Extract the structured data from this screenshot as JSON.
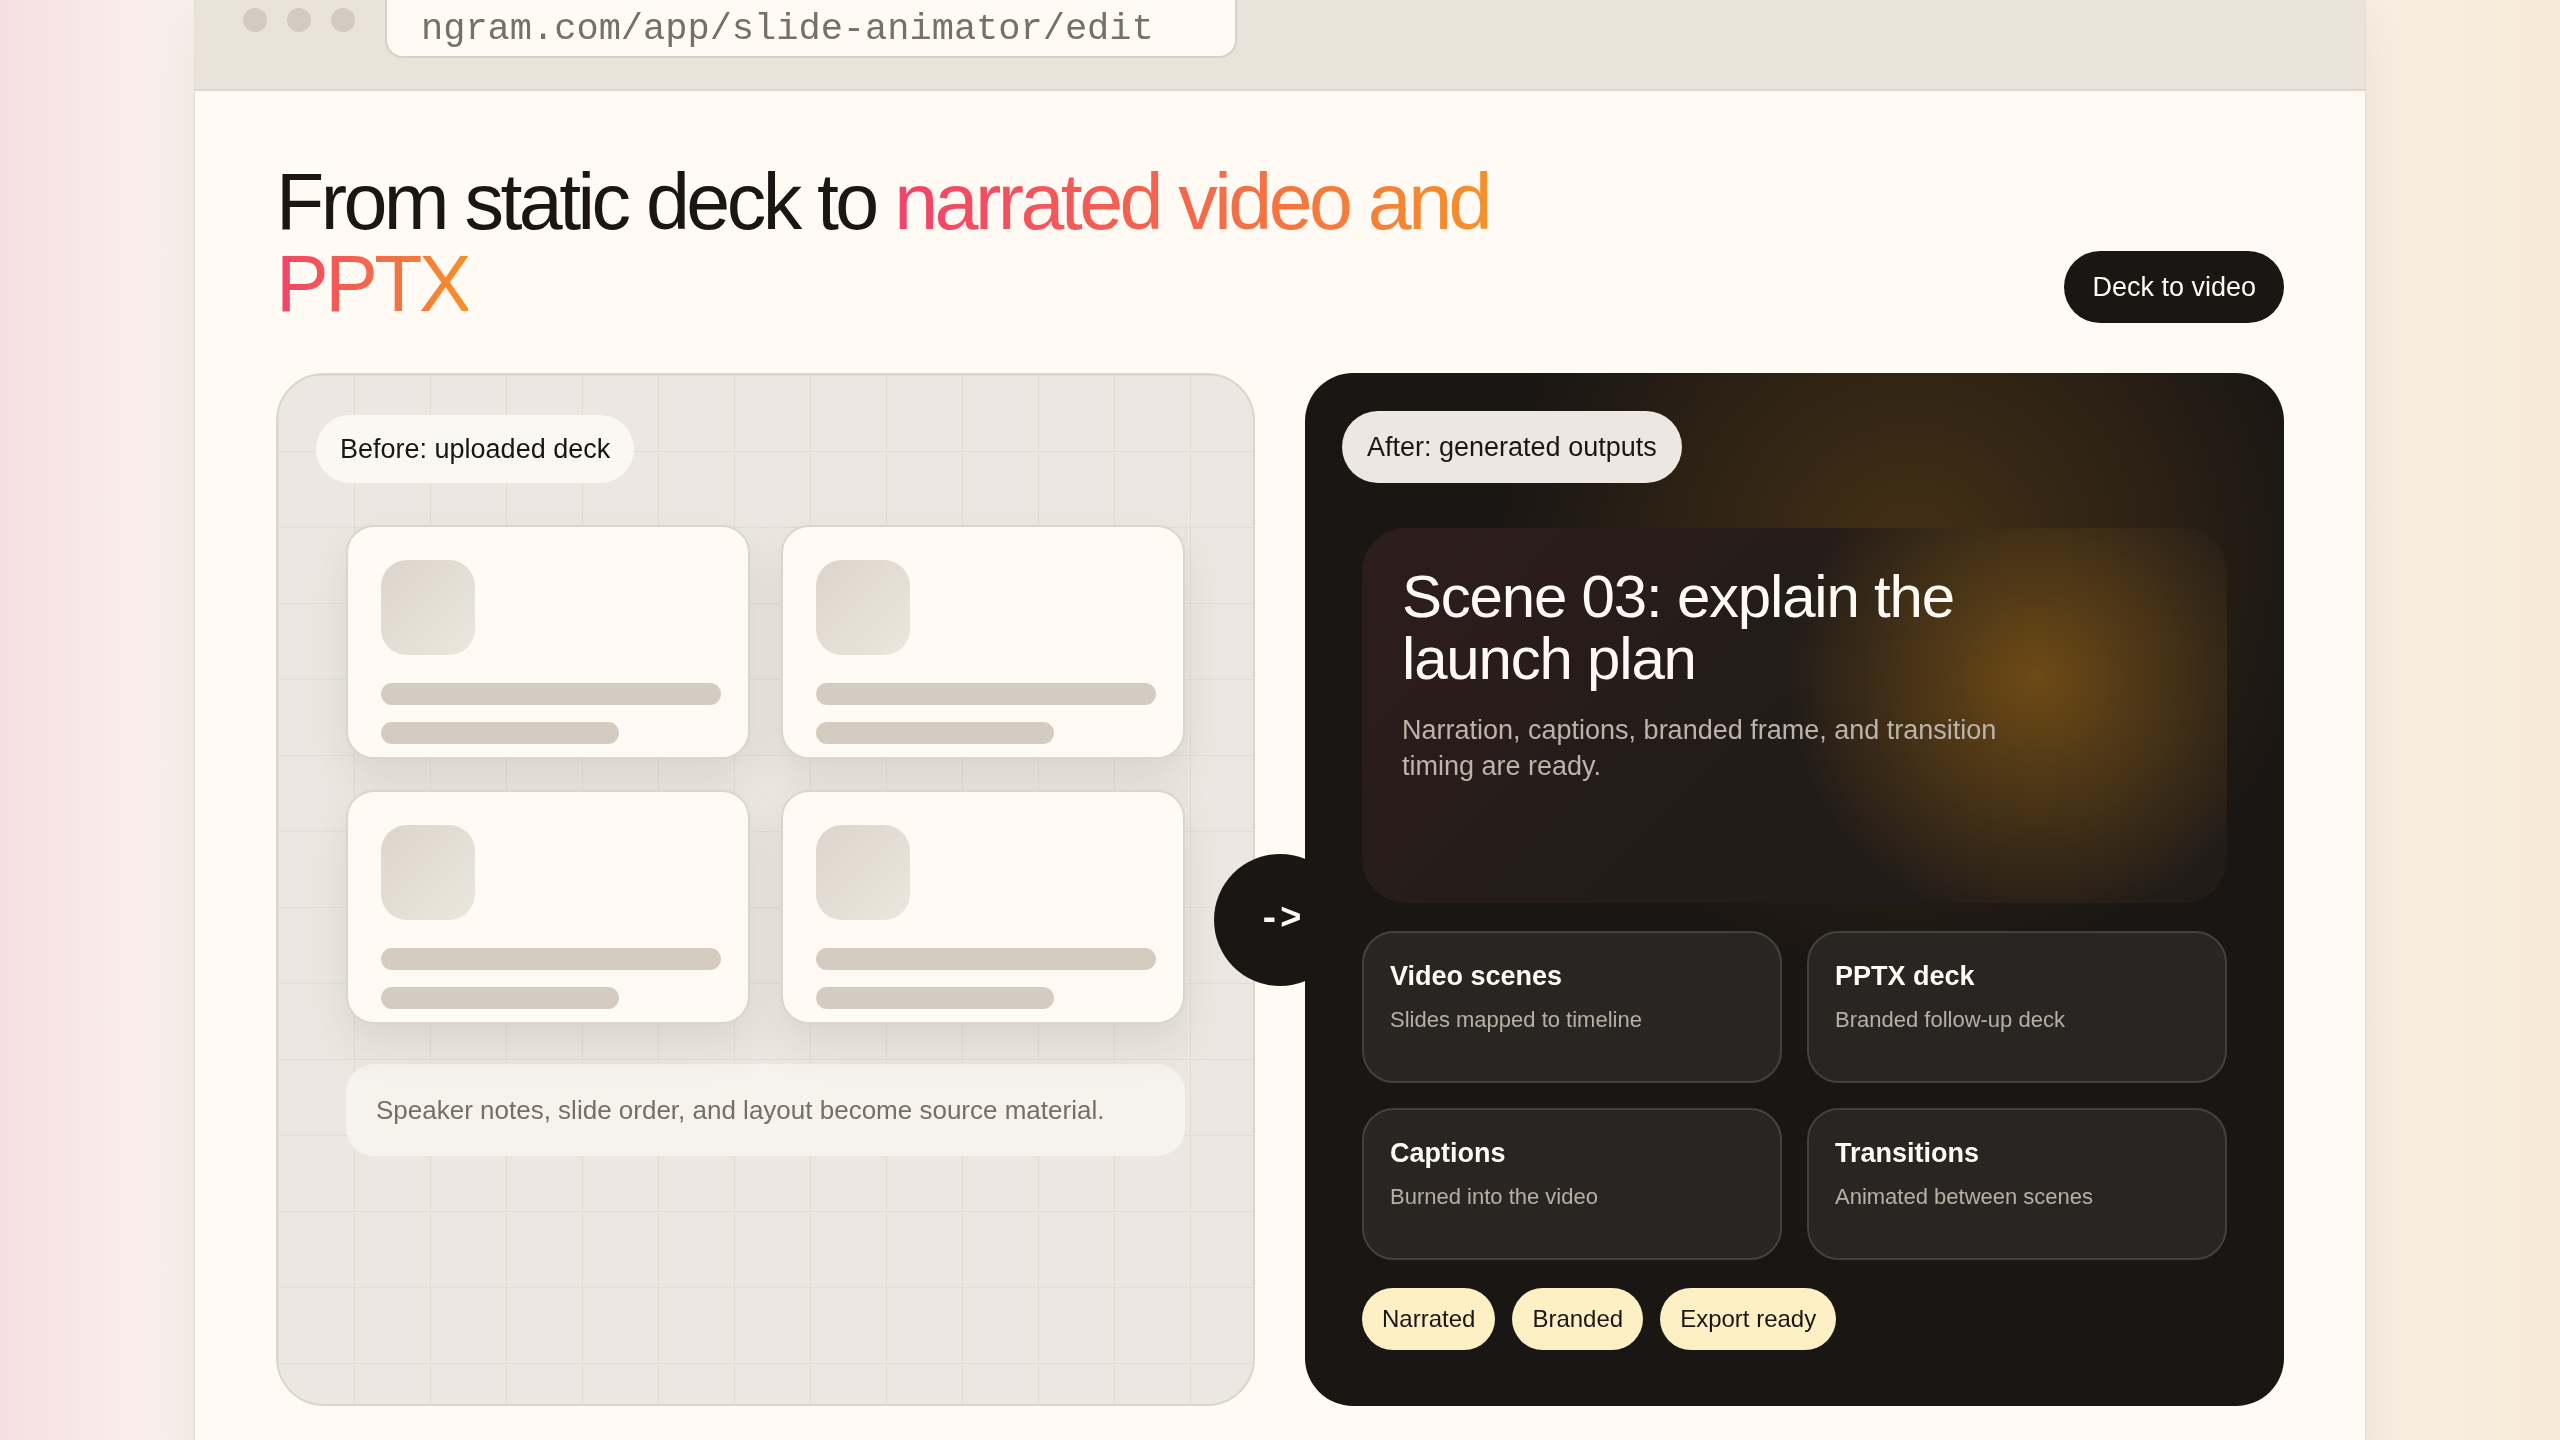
{
  "browser": {
    "url": "ngram.com/app/slide-animator/edit"
  },
  "heading": {
    "plain": "From static deck to",
    "accent": "narrated video and PPTX"
  },
  "mode_button": "Deck to video",
  "before": {
    "label": "Before: uploaded deck",
    "slides": [
      {
        "kind": "slide"
      },
      {
        "kind": "slide"
      },
      {
        "kind": "slide"
      },
      {
        "kind": "slide"
      }
    ],
    "note": "Speaker notes, slide order, and layout become source material."
  },
  "arrow": "->",
  "after": {
    "label": "After: generated outputs",
    "scene": {
      "title": "Scene 03: explain the launch plan",
      "description": "Narration, captions, branded frame, and transition timing are ready."
    },
    "outputs": [
      {
        "title": "Video scenes",
        "subtitle": "Slides mapped to timeline"
      },
      {
        "title": "PPTX deck",
        "subtitle": "Branded follow-up deck"
      },
      {
        "title": "Captions",
        "subtitle": "Burned into the video"
      },
      {
        "title": "Transitions",
        "subtitle": "Animated between scenes"
      }
    ],
    "tags": [
      "Narrated",
      "Branded",
      "Export ready"
    ]
  }
}
